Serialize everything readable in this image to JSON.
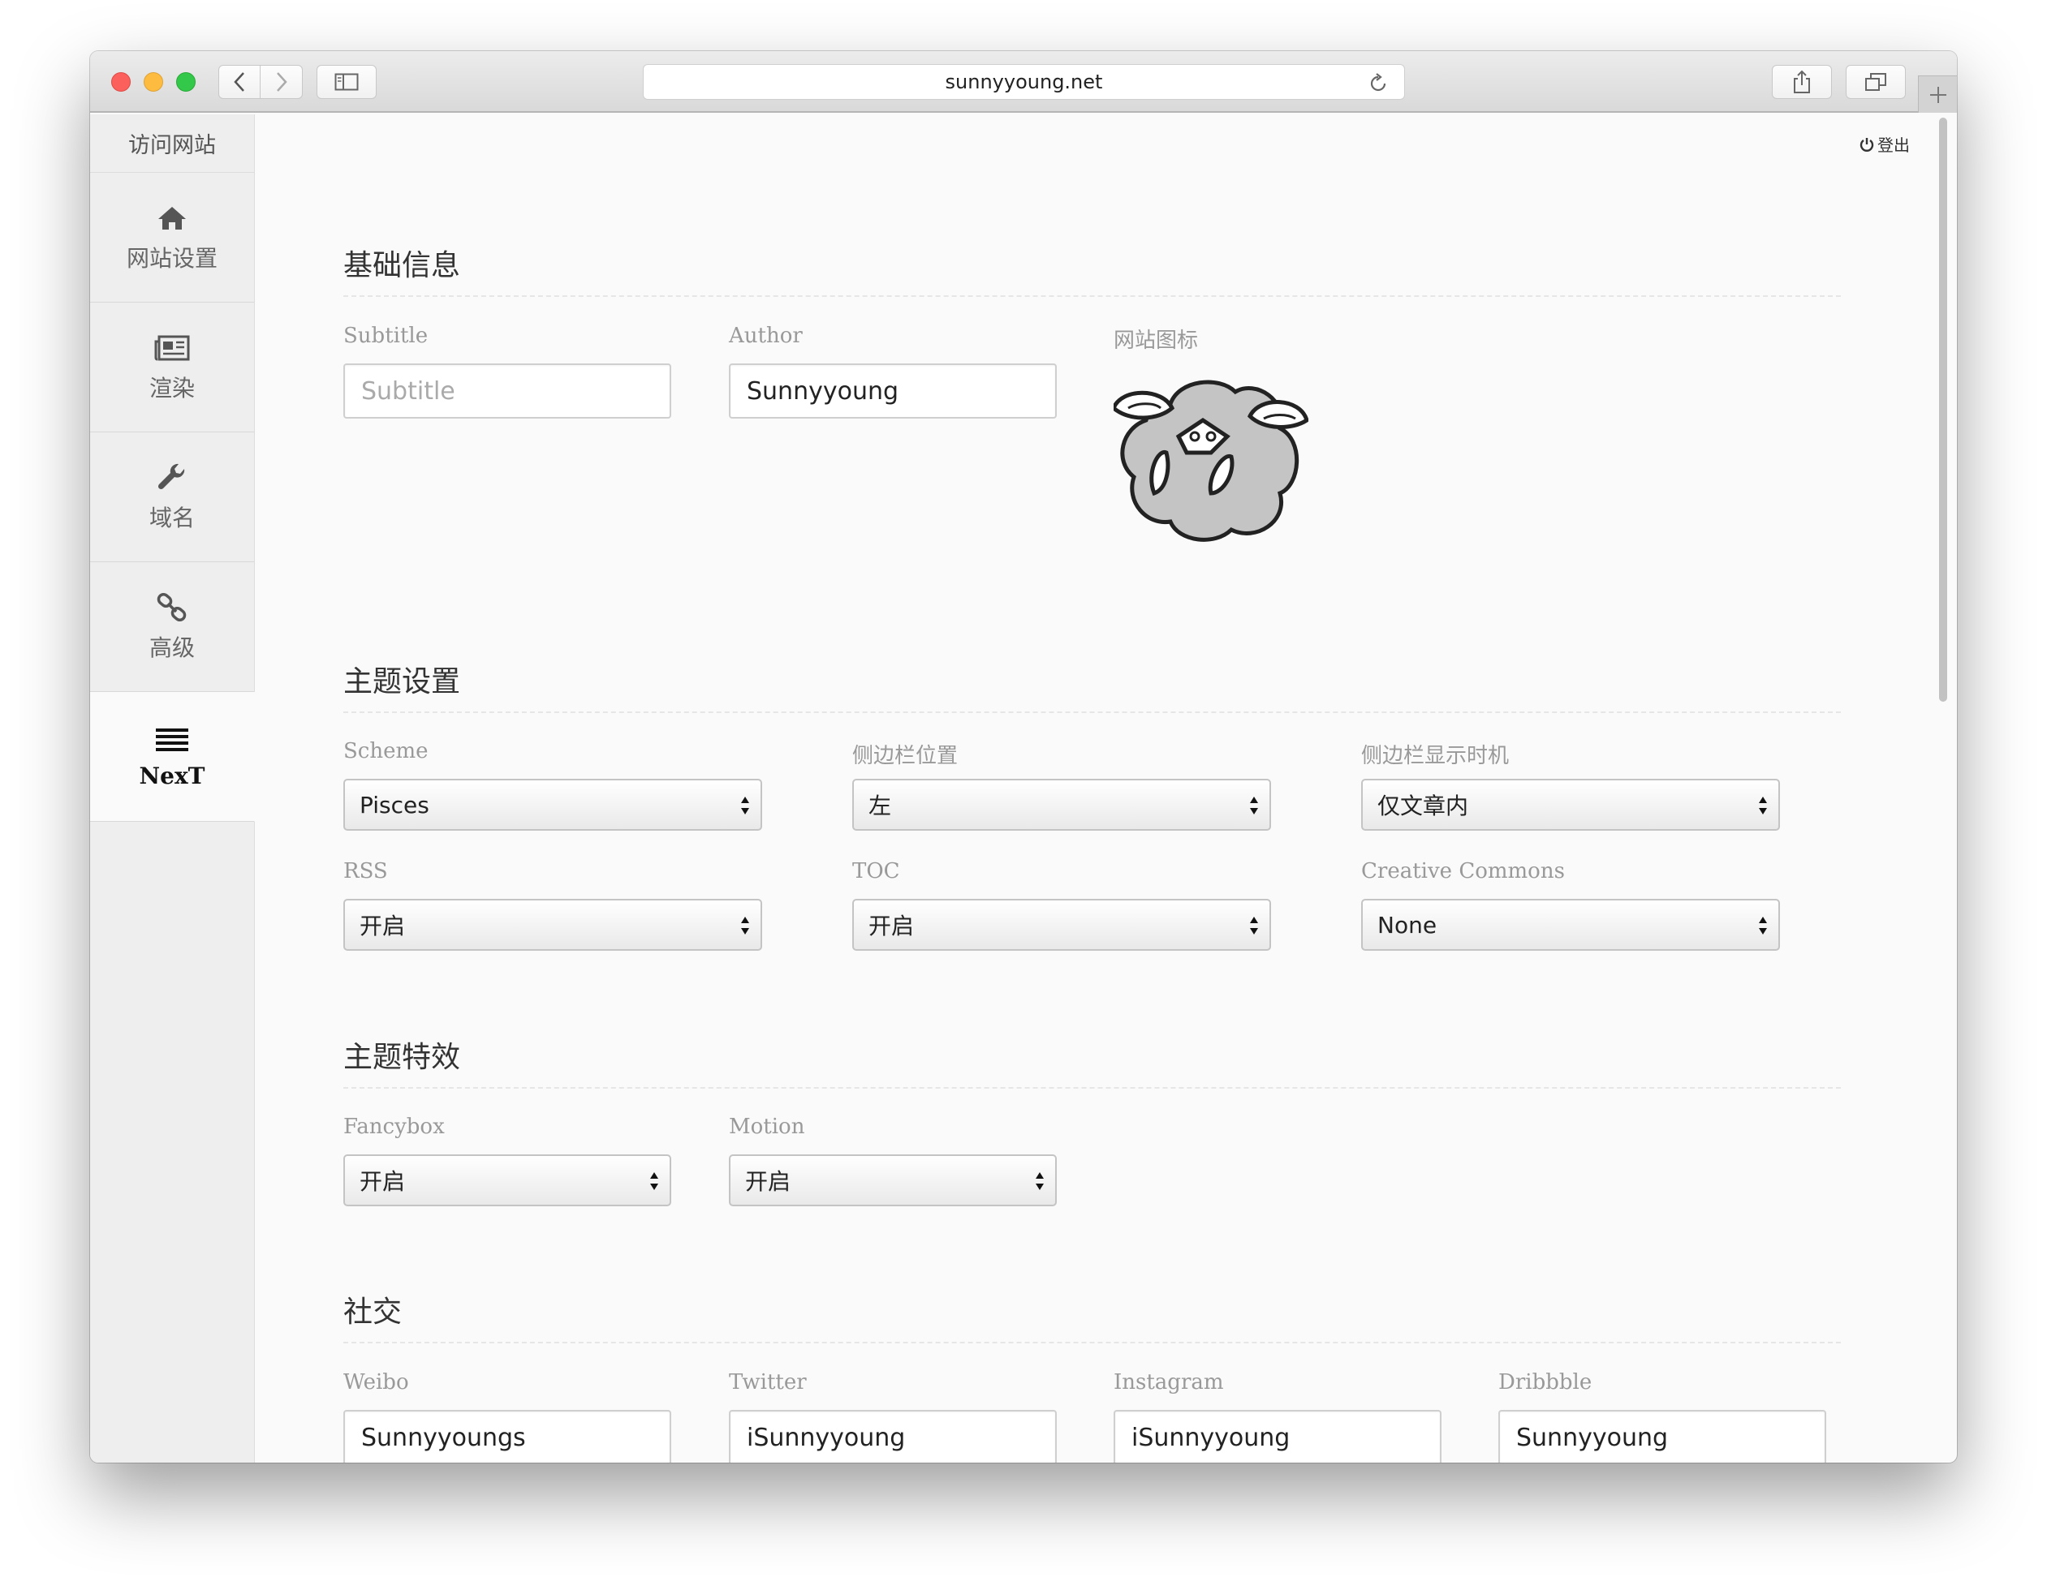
{
  "browser": {
    "url": "sunnyyoung.net"
  },
  "sidebar": {
    "visit_label": "访问网站",
    "items": [
      {
        "label": "网站设置",
        "icon": "home-icon"
      },
      {
        "label": "渲染",
        "icon": "newspaper-icon"
      },
      {
        "label": "域名",
        "icon": "wrench-icon"
      },
      {
        "label": "高级",
        "icon": "link-icon"
      },
      {
        "label": "NexT",
        "icon": "menu-icon",
        "active": true
      }
    ]
  },
  "header": {
    "logout_label": "登出"
  },
  "sections": {
    "basic": {
      "title": "基础信息",
      "subtitle_label": "Subtitle",
      "subtitle_placeholder": "Subtitle",
      "subtitle_value": "",
      "author_label": "Author",
      "author_value": "Sunnyyoung",
      "icon_label": "网站图标"
    },
    "theme": {
      "title": "主题设置",
      "scheme_label": "Scheme",
      "scheme_value": "Pisces",
      "sidebar_position_label": "侧边栏位置",
      "sidebar_position_value": "左",
      "sidebar_display_label": "侧边栏显示时机",
      "sidebar_display_value": "仅文章内",
      "rss_label": "RSS",
      "rss_value": "开启",
      "toc_label": "TOC",
      "toc_value": "开启",
      "cc_label": "Creative Commons",
      "cc_value": "None"
    },
    "effects": {
      "title": "主题特效",
      "fancybox_label": "Fancybox",
      "fancybox_value": "开启",
      "motion_label": "Motion",
      "motion_value": "开启"
    },
    "social": {
      "title": "社交",
      "weibo_label": "Weibo",
      "weibo_value": "Sunnyyoungs",
      "twitter_label": "Twitter",
      "twitter_value": "iSunnyyoung",
      "instagram_label": "Instagram",
      "instagram_value": "iSunnyyoung",
      "dribbble_label": "Dribbble",
      "dribbble_value": "Sunnyyoung"
    }
  }
}
